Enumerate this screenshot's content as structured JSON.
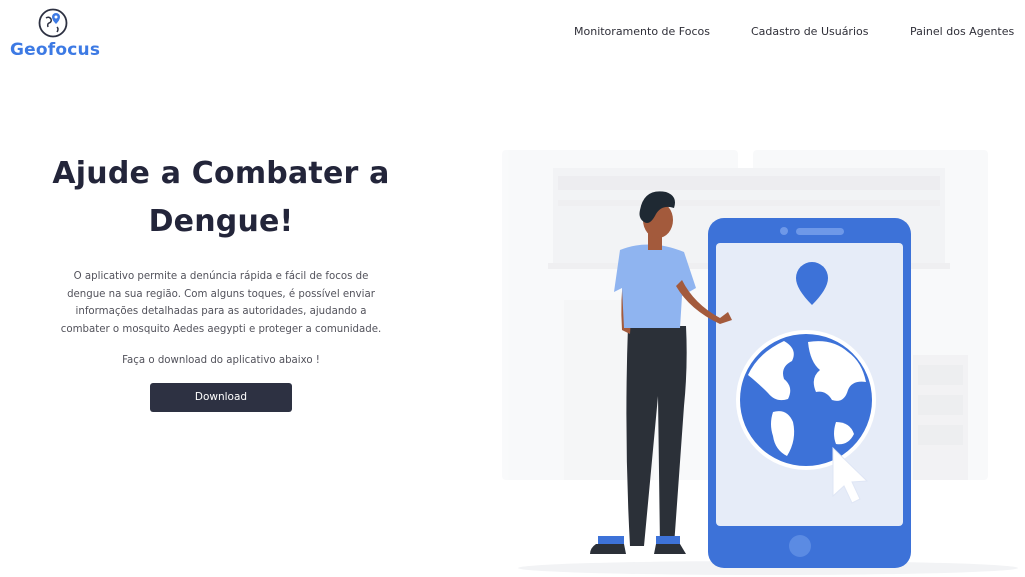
{
  "brand": {
    "name": "Geofocus",
    "icon": "globe-pin-icon"
  },
  "nav": {
    "items": [
      {
        "label": "Monitoramento de Focos"
      },
      {
        "label": "Cadastro de Usuários"
      },
      {
        "label": "Painel dos Agentes"
      }
    ]
  },
  "hero": {
    "title_line1": "Ajude a Combater a",
    "title_line2": "Dengue!",
    "paragraph_lines": [
      "O aplicativo permite a denúncia rápida e fácil de focos de",
      "dengue na sua região. Com alguns toques, é possível enviar",
      "informações detalhadas para as autoridades, ajudando a",
      "combater o mosquito Aedes aegypti e proteger a comunidade."
    ],
    "cta_text": "Faça o download do aplicativo abaixo !",
    "download_label": "Download"
  },
  "illustration": {
    "icon": "person-with-phone-globe-illustration",
    "colors": {
      "accent": "#3d7ae4",
      "dark": "#2d3142",
      "phone_screen": "#e6ecf8"
    }
  },
  "colors": {
    "brand": "#3d7ae4",
    "button": "#2d3142",
    "title": "#23253a"
  }
}
